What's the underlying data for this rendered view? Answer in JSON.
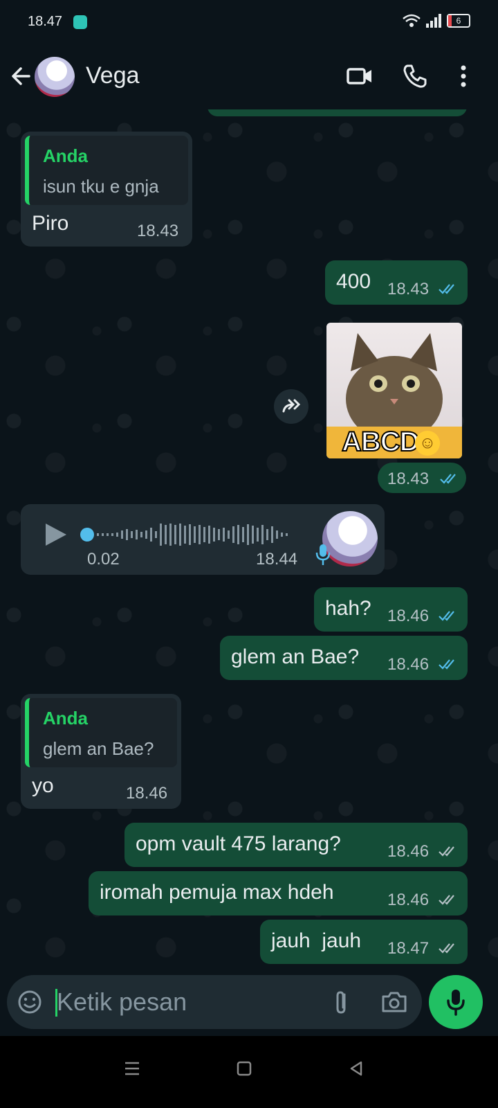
{
  "status_bar": {
    "time": "18.47",
    "battery": "6"
  },
  "header": {
    "contact_name": "Vega"
  },
  "messages": [
    {
      "type": "in-quote",
      "quote_name": "Anda",
      "quote_text": "isun tku e gnja",
      "text": "Piro",
      "time": "18.43"
    },
    {
      "type": "out",
      "text": "400",
      "time": "18.43",
      "read": true
    },
    {
      "type": "sticker",
      "caption": "ABCD",
      "time": "18.43",
      "read": true
    },
    {
      "type": "voice",
      "duration": "0.02",
      "time": "18.44"
    },
    {
      "type": "out",
      "text": "hah?",
      "time": "18.46",
      "read": true
    },
    {
      "type": "out",
      "text": "glem an Bae?",
      "time": "18.46",
      "read": true
    },
    {
      "type": "in-quote",
      "quote_name": "Anda",
      "quote_text": "glem an Bae?",
      "text": "yo",
      "time": "18.46"
    },
    {
      "type": "out",
      "text": "opm vault 475 larang?",
      "time": "18.46",
      "read": false
    },
    {
      "type": "out",
      "text": "iromah pemuja max hdeh",
      "time": "18.46",
      "read": false
    },
    {
      "type": "out",
      "text": "jauh  jauh",
      "time": "18.47",
      "read": false
    }
  ],
  "input": {
    "placeholder": "Ketik pesan"
  },
  "colors": {
    "accent": "#21c063",
    "out_bubble": "#144d37",
    "in_bubble": "#202c33",
    "read_tick": "#53bdeb",
    "unread_tick": "#b5c1c6"
  }
}
